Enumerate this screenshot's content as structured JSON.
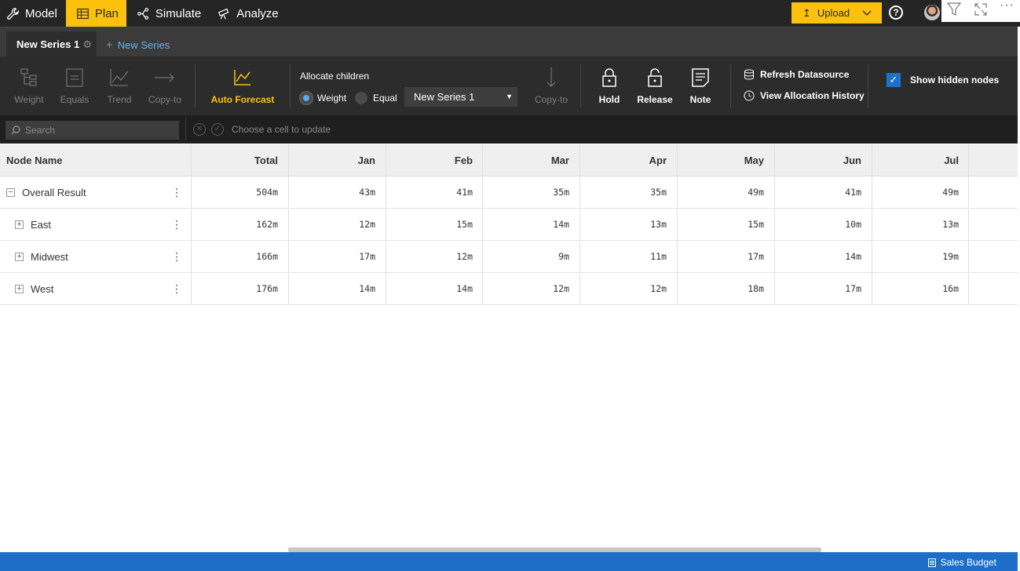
{
  "nav": {
    "items": [
      {
        "label": "Model",
        "icon": "wrench-icon"
      },
      {
        "label": "Plan",
        "icon": "table-icon"
      },
      {
        "label": "Simulate",
        "icon": "branch-icon"
      },
      {
        "label": "Analyze",
        "icon": "telescope-icon"
      }
    ],
    "active": "Plan",
    "upload_label": "Upload",
    "help_label": "?"
  },
  "tabs": {
    "current": "New Series 1",
    "new_label": "New Series"
  },
  "ribbon": {
    "weight": "Weight",
    "equals": "Equals",
    "trend": "Trend",
    "copy_to": "Copy-to",
    "auto_forecast": "Auto Forecast",
    "allocate_title": "Allocate children",
    "radio_weight": "Weight",
    "radio_equal": "Equal",
    "series_select": "New Series 1",
    "copy_to_2": "Copy-to",
    "hold": "Hold",
    "release": "Release",
    "note": "Note",
    "refresh": "Refresh Datasource",
    "history": "View Allocation History",
    "show_hidden": "Show hidden nodes",
    "accent_color": "#fcc10d"
  },
  "searchbar": {
    "placeholder": "Search",
    "hint": "Choose a cell to update"
  },
  "grid": {
    "headers": [
      "Node Name",
      "Total",
      "Jan",
      "Feb",
      "Mar",
      "Apr",
      "May",
      "Jun",
      "Jul"
    ],
    "rows": [
      {
        "toggle": "−",
        "name": "Overall Result",
        "values": [
          "504m",
          "43m",
          "41m",
          "35m",
          "35m",
          "49m",
          "41m",
          "49m"
        ]
      },
      {
        "toggle": "+",
        "name": "East",
        "values": [
          "162m",
          "12m",
          "15m",
          "14m",
          "13m",
          "15m",
          "10m",
          "13m"
        ]
      },
      {
        "toggle": "+",
        "name": "Midwest",
        "values": [
          "166m",
          "17m",
          "12m",
          "9m",
          "11m",
          "17m",
          "14m",
          "19m"
        ]
      },
      {
        "toggle": "+",
        "name": "West",
        "values": [
          "176m",
          "14m",
          "14m",
          "12m",
          "12m",
          "18m",
          "17m",
          "16m"
        ]
      }
    ]
  },
  "status": {
    "report_name": "Sales Budget"
  }
}
